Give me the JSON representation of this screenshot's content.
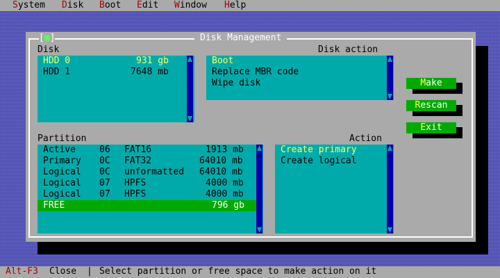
{
  "menu": [
    {
      "hotkey": "S",
      "rest": "ystem"
    },
    {
      "hotkey": "D",
      "rest": "isk"
    },
    {
      "hotkey": "B",
      "rest": "oot"
    },
    {
      "hotkey": "E",
      "rest": "dit"
    },
    {
      "hotkey": "W",
      "rest": "indow"
    },
    {
      "hotkey": "H",
      "rest": "elp"
    }
  ],
  "dialog": {
    "title": "Disk Management",
    "close_box": "[■]"
  },
  "disk_panel": {
    "label": "Disk",
    "items": [
      {
        "name": "HDD 0",
        "size": "931 gb",
        "selected": true
      },
      {
        "name": "HDD 1",
        "size": "7648 mb",
        "selected": false
      }
    ]
  },
  "disk_action_panel": {
    "label": "Disk action",
    "items": [
      {
        "label": "Boot",
        "selected": true
      },
      {
        "label": "Replace MBR code",
        "selected": false
      },
      {
        "label": "Wipe disk",
        "selected": false
      }
    ]
  },
  "partition_panel": {
    "label": "Partition",
    "rows": [
      {
        "type": "Active",
        "id": "06",
        "fs": "FAT16",
        "size": "1913 mb"
      },
      {
        "type": "Primary",
        "id": "0C",
        "fs": "FAT32",
        "size": "64010 mb"
      },
      {
        "type": "Logical",
        "id": "0C",
        "fs": "unformatted",
        "size": "64010 mb"
      },
      {
        "type": "Logical",
        "id": "07",
        "fs": "HPFS",
        "size": "4000 mb"
      },
      {
        "type": "Logical",
        "id": "07",
        "fs": "HPFS",
        "size": "4000 mb"
      },
      {
        "type": "FREE",
        "id": "",
        "fs": "",
        "size": "796 gb"
      }
    ]
  },
  "action_panel": {
    "label": "Action",
    "items": [
      {
        "label": "Create primary",
        "selected": true
      },
      {
        "label": "Create logical",
        "selected": false
      }
    ]
  },
  "buttons": {
    "make": {
      "hotkey": "M",
      "rest": "ake"
    },
    "rescan": {
      "hotkey": "R",
      "rest": "escan"
    },
    "exit": {
      "hotkey": "E",
      "rest": "xit"
    }
  },
  "status": {
    "key": "Alt-F3",
    "key_action": "Close",
    "separator": "|",
    "hint": "Select partition or free space to make action on it"
  },
  "colors": {
    "desktop": "#5050b0",
    "chrome_gray": "#aaaaaa",
    "list_cyan": "#00aaaa",
    "cursor_green": "#00aa00",
    "selected_yellow": "#ffff55",
    "hotkey_red": "#aa0000",
    "scrollbar_blue": "#0000aa"
  },
  "icons": [
    "scroll-up-arrow-icon",
    "scroll-down-arrow-icon"
  ]
}
